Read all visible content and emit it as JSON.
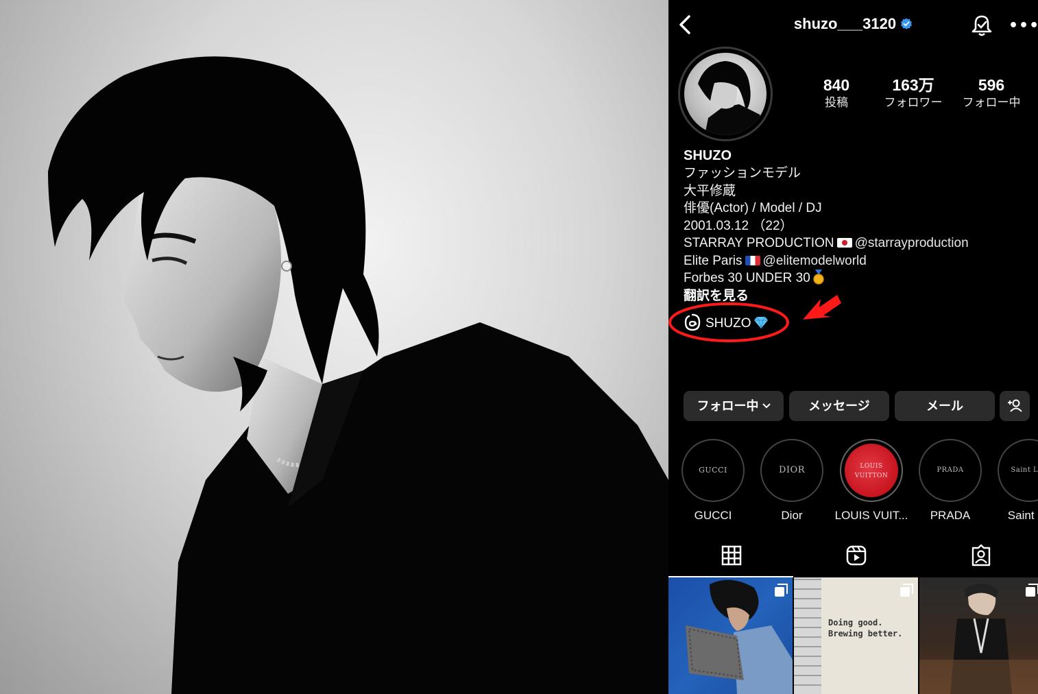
{
  "profile": {
    "username": "shuzo___3120",
    "stats": [
      {
        "value": "840",
        "label": "投稿"
      },
      {
        "value": "163万",
        "label": "フォロワー"
      },
      {
        "value": "596",
        "label": "フォロー中"
      }
    ],
    "bio": {
      "name": "SHUZO",
      "lines": [
        "ファッションモデル",
        "大平修蔵",
        "俳優(Actor) / Model / DJ",
        "2001.03.12 （22）"
      ],
      "starray_text": "STARRAY PRODUCTION",
      "starray_handle": "@starrayproduction",
      "elite_text": "Elite Paris",
      "elite_handle": "@elitemodelworld",
      "forbes_text": "Forbes 30 UNDER 30",
      "translate": "翻訳を見る"
    },
    "threads_label": "SHUZO",
    "actions": {
      "following": "フォロー中",
      "message": "メッセージ",
      "email": "メール"
    },
    "highlights": [
      {
        "cover": "GUCCI",
        "label": "GUCCI"
      },
      {
        "cover": "DIOR",
        "label": "Dior"
      },
      {
        "cover": "LOUIS VUITTON",
        "label": "LOUIS VUIT..."
      },
      {
        "cover": "PRADA",
        "label": "PRADA"
      },
      {
        "cover": "Saint Lau",
        "label": "Saint La"
      }
    ],
    "posts": {
      "post2_text": "Doing good. Brewing better."
    }
  },
  "colors": {
    "background": "#000000",
    "button": "#2b2b2b",
    "verified": "#3897f0",
    "annotation": "#ff1a1a"
  },
  "icons": [
    "back-chevron-icon",
    "verified-icon",
    "bell-icon",
    "more-icon",
    "threads-icon",
    "diamond-emoji",
    "medal-emoji",
    "add-person-icon",
    "grid-icon",
    "reels-icon",
    "tagged-icon",
    "carousel-icon"
  ]
}
